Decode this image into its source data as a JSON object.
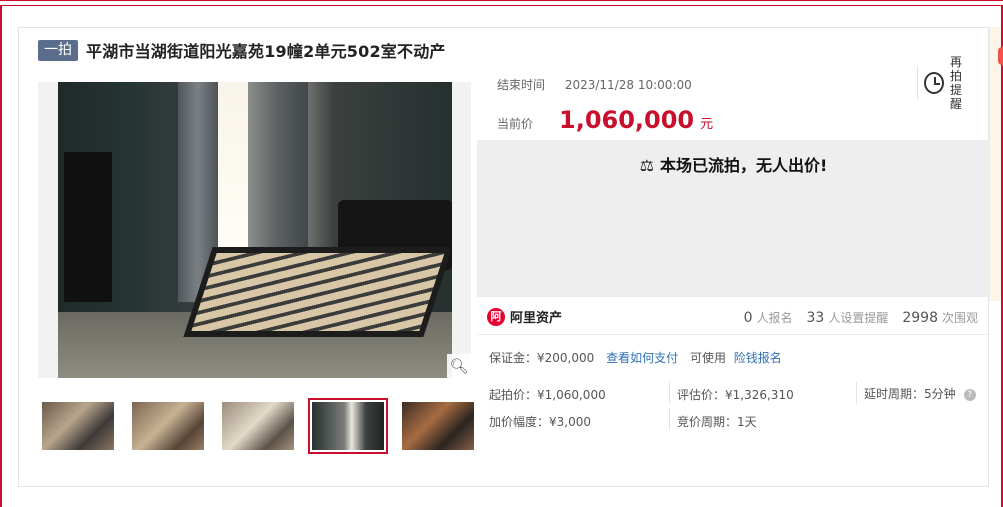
{
  "header": {
    "round_badge": "一拍",
    "title": "平湖市当湖街道阳光嘉苑19幢2单元502室不动产"
  },
  "auction": {
    "end_time_label": "结束时间",
    "end_time_value": "2023/11/28 10:00:00",
    "reminder_label": "再拍提醒",
    "current_price_label": "当前价",
    "current_price_value": "1,060,000",
    "current_price_unit": "元",
    "status_text": "本场已流拍，无人出价!"
  },
  "platform": {
    "logo_text": "阿里资产",
    "signups_count": "0",
    "signups_label": "人报名",
    "reminders_count": "33",
    "reminders_label": "人设置提醒",
    "views_count": "2998",
    "views_label": "次围观"
  },
  "deposit": {
    "text": "保证金：¥200,000",
    "how_to_pay_link": "查看如何支付",
    "available_text": "可使用",
    "insurance_link": "险钱报名"
  },
  "details": {
    "start_price": "起拍价：¥1,060,000",
    "appraised_price": "评估价：¥1,326,310",
    "delay_period": "延时周期：5分钟",
    "increment": "加价幅度：¥3,000",
    "bidding_period": "竞价周期：1天"
  },
  "icons": {
    "zoom": "magnifier-icon",
    "reminder": "alarm-clock-icon",
    "status": "gavel-icon",
    "help": "question-icon"
  },
  "thumbnails": [
    {
      "active": false
    },
    {
      "active": false
    },
    {
      "active": false
    },
    {
      "active": true
    },
    {
      "active": false
    }
  ]
}
